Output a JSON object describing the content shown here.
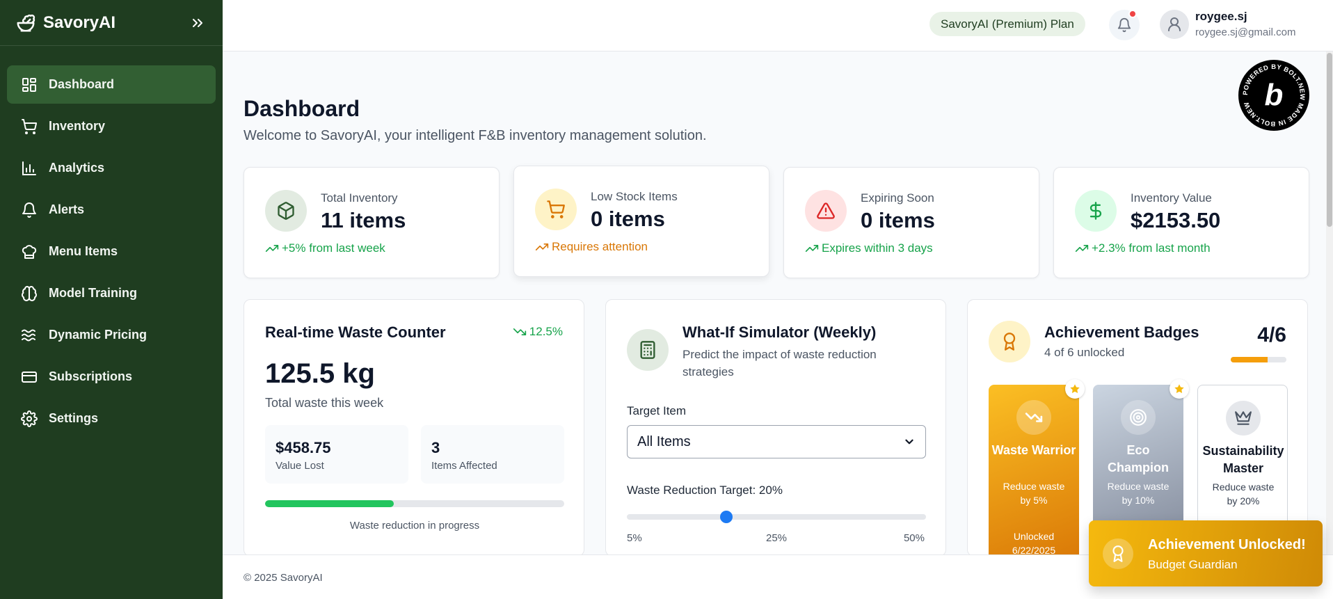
{
  "brand": {
    "name": "SavoryAI"
  },
  "sidebar": {
    "items": [
      {
        "label": "Dashboard",
        "icon": "dashboard-icon",
        "active": true
      },
      {
        "label": "Inventory",
        "icon": "cart-icon"
      },
      {
        "label": "Analytics",
        "icon": "bar-chart-icon"
      },
      {
        "label": "Alerts",
        "icon": "bell-icon"
      },
      {
        "label": "Menu Items",
        "icon": "chef-hat-icon"
      },
      {
        "label": "Model Training",
        "icon": "brain-icon"
      },
      {
        "label": "Dynamic Pricing",
        "icon": "waves-icon"
      },
      {
        "label": "Subscriptions",
        "icon": "credit-card-icon"
      },
      {
        "label": "Settings",
        "icon": "gear-icon"
      }
    ]
  },
  "header": {
    "plan": "SavoryAI (Premium) Plan",
    "user_name": "roygee.sj",
    "user_email": "roygee.sj@gmail.com"
  },
  "badge_logo": {
    "text": "POWERED BY BOLT.NEW MADE IN BOLT.NEW",
    "letter": "b"
  },
  "page": {
    "title": "Dashboard",
    "subtitle": "Welcome to SavoryAI, your intelligent F&B inventory management solution."
  },
  "stats": [
    {
      "label": "Total Inventory",
      "value": "11 items",
      "trend": "+5% from last week",
      "color": "#16a34a",
      "icon": "box-icon"
    },
    {
      "label": "Low Stock Items",
      "value": "0 items",
      "trend": "Requires attention",
      "color": "#d97706",
      "icon": "cart-icon"
    },
    {
      "label": "Expiring Soon",
      "value": "0 items",
      "trend": "Expires within 3 days",
      "color": "#16a34a",
      "icon": "warning-icon"
    },
    {
      "label": "Inventory Value",
      "value": "$2153.50",
      "trend": "+2.3% from last month",
      "color": "#16a34a",
      "icon": "dollar-icon"
    }
  ],
  "waste": {
    "title": "Real-time Waste Counter",
    "trend": "12.5%",
    "value": "125.5 kg",
    "sub": "Total waste this week",
    "value_lost": "$458.75",
    "value_lost_label": "Value Lost",
    "items_affected": "3",
    "items_affected_label": "Items Affected",
    "progress": 0.43,
    "caption": "Waste reduction in progress"
  },
  "simulator": {
    "title": "What-If Simulator (Weekly)",
    "subtitle": "Predict the impact of waste reduction strategies",
    "target_label": "Target Item",
    "target_value": "All Items",
    "range_label": "Waste Reduction Target: 20%",
    "range_min": 5,
    "range_max": 50,
    "range_value": 20,
    "ticks": [
      "5%",
      "25%",
      "50%"
    ]
  },
  "achievements": {
    "title": "Achievement Badges",
    "subtitle": "4 of 6 unlocked",
    "count": "4/6",
    "progress": 0.667,
    "badges": [
      {
        "name": "Waste Warrior",
        "desc": "Reduce waste by 5%",
        "date_label": "Unlocked",
        "date": "6/22/2025",
        "style": "gold",
        "icon": "trend-down-icon"
      },
      {
        "name": "Eco Champion",
        "desc": "Reduce waste by 10%",
        "style": "silver",
        "icon": "target-icon"
      },
      {
        "name": "Sustainability Master",
        "desc": "Reduce waste by 20%",
        "style": "locked",
        "icon": "crown-icon"
      }
    ]
  },
  "footer": {
    "text": "© 2025 SavoryAI"
  },
  "toast": {
    "title": "Achievement Unlocked!",
    "subtitle": "Budget Guardian"
  }
}
